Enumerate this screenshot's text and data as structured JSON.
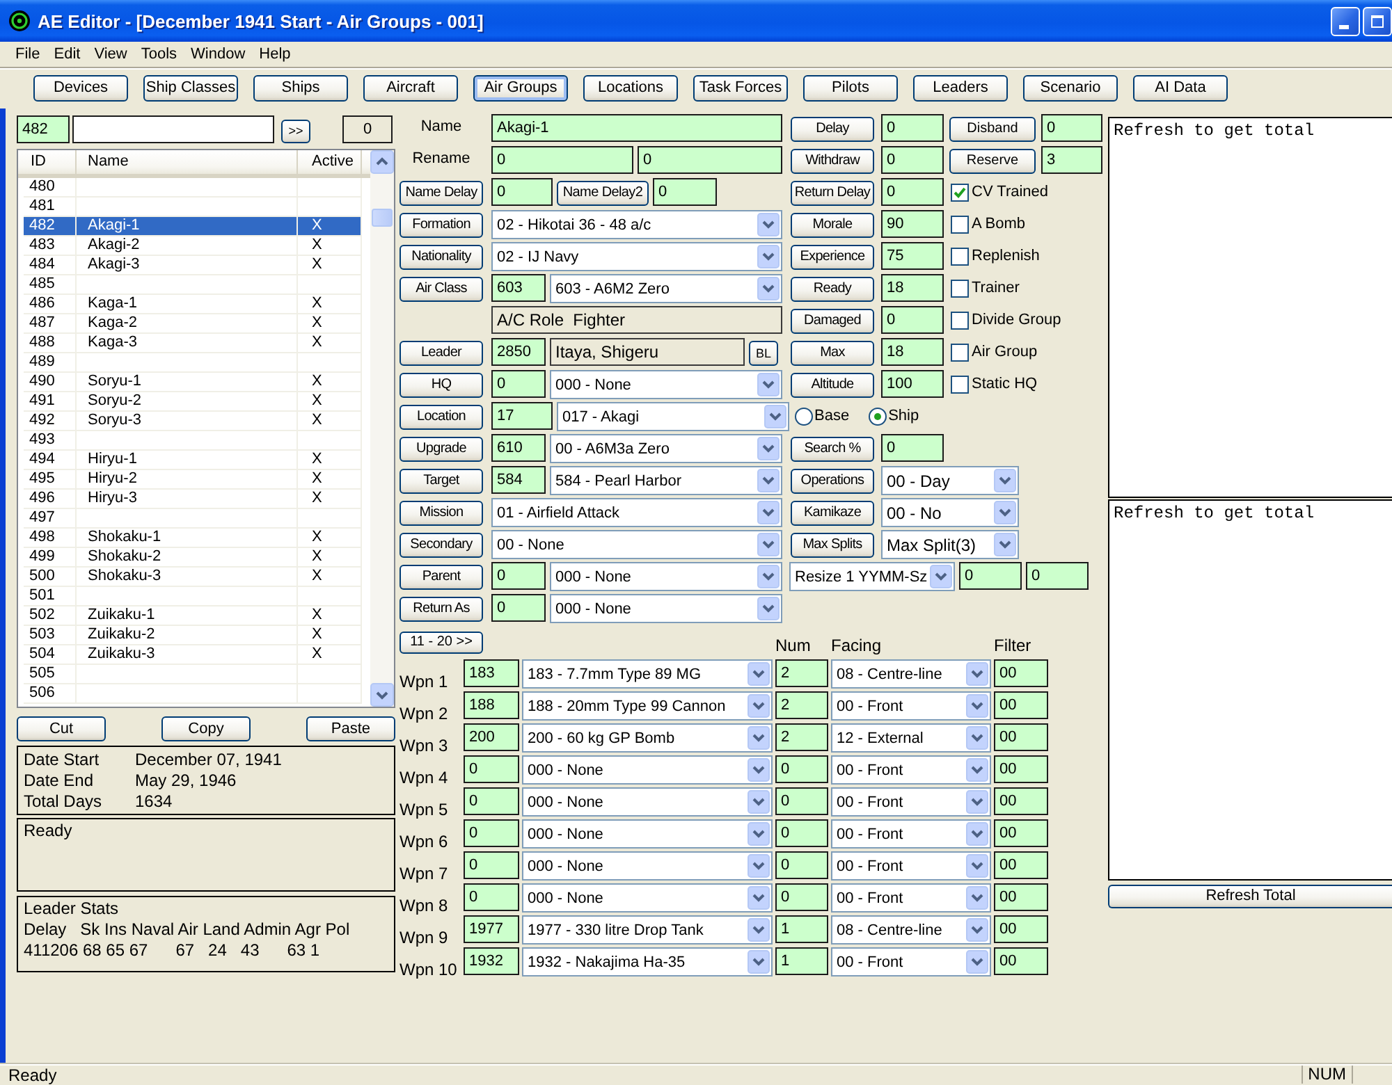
{
  "window": {
    "title": "AE Editor - [December 1941 Start - Air Groups - 001]"
  },
  "menu": [
    "File",
    "Edit",
    "View",
    "Tools",
    "Window",
    "Help"
  ],
  "toolbar": [
    {
      "label": "Devices",
      "selected": false
    },
    {
      "label": "Ship Classes",
      "selected": false
    },
    {
      "label": "Ships",
      "selected": false
    },
    {
      "label": "Aircraft",
      "selected": false
    },
    {
      "label": "Air Groups",
      "selected": true
    },
    {
      "label": "Locations",
      "selected": false
    },
    {
      "label": "Task Forces",
      "selected": false
    },
    {
      "label": "Pilots",
      "selected": false
    },
    {
      "label": "Leaders",
      "selected": false
    },
    {
      "label": "Scenario",
      "selected": false
    },
    {
      "label": "AI Data",
      "selected": false
    }
  ],
  "finder": {
    "id": "482",
    "go": ">>",
    "count": "0"
  },
  "list": {
    "columns": [
      "ID",
      "Name",
      "Active"
    ],
    "rows": [
      {
        "id": "480",
        "selected": false
      },
      {
        "id": "481",
        "selected": false
      },
      {
        "id": "482",
        "name": "Akagi-1",
        "active": "X",
        "selected": true
      },
      {
        "id": "483",
        "name": "Akagi-2",
        "active": "X",
        "selected": false
      },
      {
        "id": "484",
        "name": "Akagi-3",
        "active": "X",
        "selected": false
      },
      {
        "id": "485",
        "selected": false
      },
      {
        "id": "486",
        "name": "Kaga-1",
        "active": "X",
        "selected": false
      },
      {
        "id": "487",
        "name": "Kaga-2",
        "active": "X",
        "selected": false
      },
      {
        "id": "488",
        "name": "Kaga-3",
        "active": "X",
        "selected": false
      },
      {
        "id": "489",
        "selected": false
      },
      {
        "id": "490",
        "name": "Soryu-1",
        "active": "X",
        "selected": false
      },
      {
        "id": "491",
        "name": "Soryu-2",
        "active": "X",
        "selected": false
      },
      {
        "id": "492",
        "name": "Soryu-3",
        "active": "X",
        "selected": false
      },
      {
        "id": "493",
        "selected": false
      },
      {
        "id": "494",
        "name": "Hiryu-1",
        "active": "X",
        "selected": false
      },
      {
        "id": "495",
        "name": "Hiryu-2",
        "active": "X",
        "selected": false
      },
      {
        "id": "496",
        "name": "Hiryu-3",
        "active": "X",
        "selected": false
      },
      {
        "id": "497",
        "selected": false
      },
      {
        "id": "498",
        "name": "Shokaku-1",
        "active": "X",
        "selected": false
      },
      {
        "id": "499",
        "name": "Shokaku-2",
        "active": "X",
        "selected": false
      },
      {
        "id": "500",
        "name": "Shokaku-3",
        "active": "X",
        "selected": false
      },
      {
        "id": "501",
        "selected": false
      },
      {
        "id": "502",
        "name": "Zuikaku-1",
        "active": "X",
        "selected": false
      },
      {
        "id": "503",
        "name": "Zuikaku-2",
        "active": "X",
        "selected": false
      },
      {
        "id": "504",
        "name": "Zuikaku-3",
        "active": "X",
        "selected": false
      },
      {
        "id": "505",
        "selected": false
      },
      {
        "id": "506",
        "selected": false
      }
    ]
  },
  "list_buttons": [
    "Cut",
    "Copy",
    "Paste"
  ],
  "dates": [
    {
      "label": "Date Start",
      "value": "December 07, 1941"
    },
    {
      "label": "Date End",
      "value": "May 29, 1946"
    },
    {
      "label": "Total Days",
      "value": "1634"
    }
  ],
  "log": "Ready",
  "leader_stats": {
    "title": "Leader Stats",
    "lines": [
      "Delay   Sk Ins Naval Air Land Admin Agr Pol",
      "411206 68 65 67      67   24   43      63 1"
    ]
  },
  "form": [
    {
      "kind": "text",
      "label": "Name",
      "value": "Akagi-1"
    },
    {
      "kind": "pair",
      "label": "Rename",
      "values": [
        "0",
        "0"
      ]
    },
    {
      "kind": "delays",
      "items": [
        {
          "button": "Name Delay",
          "value": "0"
        },
        {
          "button": "Name Delay2",
          "value": "0"
        }
      ]
    },
    {
      "kind": "combo",
      "button": "Formation",
      "option": "02 - Hikotai 36 - 48 a/c"
    },
    {
      "kind": "combo",
      "button": "Nationality",
      "option": "02 - IJ Navy"
    },
    {
      "kind": "code_combo",
      "button": "Air Class",
      "code": "603",
      "option": "603 - A6M2 Zero"
    },
    {
      "kind": "info",
      "text": "A/C Role  Fighter"
    },
    {
      "kind": "leader",
      "button": "Leader",
      "code": "2850",
      "leader": "Itaya, Shigeru",
      "extra": "BL"
    },
    {
      "kind": "code_combo",
      "button": "HQ",
      "code": "0",
      "option": "000 - None"
    },
    {
      "kind": "wide_code_combo",
      "button": "Location",
      "code": "17",
      "option": "017 - Akagi"
    },
    {
      "kind": "code_combo",
      "button": "Upgrade",
      "code": "610",
      "option": "00 - A6M3a Zero"
    },
    {
      "kind": "code_combo",
      "button": "Target",
      "code": "584",
      "option": "584 - Pearl Harbor"
    },
    {
      "kind": "combo",
      "button": "Mission",
      "option": "01 - Airfield Attack"
    },
    {
      "kind": "combo",
      "button": "Secondary",
      "option": "00 - None"
    },
    {
      "kind": "code_combo",
      "button": "Parent",
      "code": "0",
      "option": "000 - None"
    },
    {
      "kind": "code_combo",
      "button": "Return As",
      "code": "0",
      "option": "000 - None"
    }
  ],
  "counters": [
    {
      "button": "Delay",
      "value": "0",
      "extra": {
        "kind": "button",
        "label": "Disband",
        "value": "0"
      }
    },
    {
      "button": "Withdraw",
      "value": "0",
      "extra": {
        "kind": "button",
        "label": "Reserve",
        "value": "3"
      }
    },
    {
      "button": "Return Delay",
      "value": "0",
      "extra": {
        "kind": "check",
        "label": "CV Trained",
        "checked": true
      }
    },
    {
      "button": "Morale",
      "value": "90",
      "extra": {
        "kind": "check",
        "label": "A Bomb",
        "checked": false
      }
    },
    {
      "button": "Experience",
      "value": "75",
      "extra": {
        "kind": "check",
        "label": "Replenish",
        "checked": false
      }
    },
    {
      "button": "Ready",
      "value": "18",
      "extra": {
        "kind": "check",
        "label": "Trainer",
        "checked": false
      }
    },
    {
      "button": "Damaged",
      "value": "0",
      "extra": {
        "kind": "check",
        "label": "Divide Group",
        "checked": false
      }
    },
    {
      "button": "Max",
      "value": "18",
      "extra": {
        "kind": "check",
        "label": "Air Group",
        "checked": false
      }
    },
    {
      "button": "Altitude",
      "value": "100",
      "extra": {
        "kind": "check",
        "label": "Static HQ",
        "checked": false
      }
    }
  ],
  "basing": [
    {
      "label": "Base",
      "selected": false
    },
    {
      "label": "Ship",
      "selected": true
    }
  ],
  "search": {
    "button": "Search %",
    "value": "0"
  },
  "options": [
    {
      "button": "Operations",
      "option": "00 - Day"
    },
    {
      "button": "Kamikaze",
      "option": "00 - No"
    },
    {
      "button": "Max Splits",
      "option": "Max Split(3)"
    }
  ],
  "resize": {
    "option": "Resize 1 YYMM-Sz",
    "values": [
      "0",
      "0"
    ]
  },
  "weapons": {
    "more": "11 - 20 >>",
    "columns": [
      "Num",
      "Facing",
      "Filter"
    ],
    "rows": [
      {
        "label": "Wpn 1",
        "code": "183",
        "device": "183 - 7.7mm Type 89 MG",
        "num": "2",
        "facing": "08 - Centre-line",
        "filter": "00"
      },
      {
        "label": "Wpn 2",
        "code": "188",
        "device": "188 - 20mm Type 99 Cannon",
        "num": "2",
        "facing": "00 - Front",
        "filter": "00"
      },
      {
        "label": "Wpn 3",
        "code": "200",
        "device": "200 - 60 kg GP Bomb",
        "num": "2",
        "facing": "12 - External",
        "filter": "00"
      },
      {
        "label": "Wpn 4",
        "code": "0",
        "device": "000 - None",
        "num": "0",
        "facing": "00 - Front",
        "filter": "00"
      },
      {
        "label": "Wpn 5",
        "code": "0",
        "device": "000 - None",
        "num": "0",
        "facing": "00 - Front",
        "filter": "00"
      },
      {
        "label": "Wpn 6",
        "code": "0",
        "device": "000 - None",
        "num": "0",
        "facing": "00 - Front",
        "filter": "00"
      },
      {
        "label": "Wpn 7",
        "code": "0",
        "device": "000 - None",
        "num": "0",
        "facing": "00 - Front",
        "filter": "00"
      },
      {
        "label": "Wpn 8",
        "code": "0",
        "device": "000 - None",
        "num": "0",
        "facing": "00 - Front",
        "filter": "00"
      },
      {
        "label": "Wpn 9",
        "code": "1977",
        "device": "1977 - 330 litre Drop Tank",
        "num": "1",
        "facing": "08 - Centre-line",
        "filter": "00"
      },
      {
        "label": "Wpn 10",
        "code": "1932",
        "device": "1932 - Nakajima Ha-35",
        "num": "1",
        "facing": "00 - Front",
        "filter": "00"
      }
    ]
  },
  "totals": {
    "areas": [
      "Refresh to get total",
      "Refresh to get total"
    ],
    "button": "Refresh Total"
  },
  "status_bar": {
    "text": "Ready",
    "indicator": "NUM"
  }
}
